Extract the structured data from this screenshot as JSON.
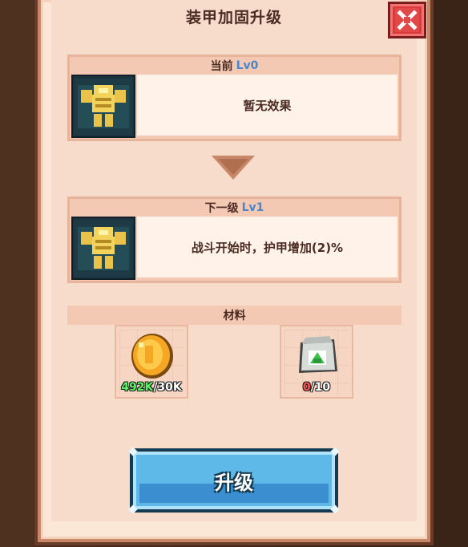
{
  "dialog": {
    "title": "装甲加固升级"
  },
  "current": {
    "label": "当前",
    "level": "Lv0",
    "effect": "暂无效果"
  },
  "next": {
    "label": "下一级",
    "level": "Lv1",
    "effect": "战斗开始时，护甲增加(2)%"
  },
  "materials": {
    "header": "材料",
    "items": [
      {
        "name": "coin",
        "have": "492K",
        "need": "/30K",
        "have_status": "sufficient"
      },
      {
        "name": "material-bag",
        "have": "0",
        "need": "/10",
        "have_status": "insufficient"
      }
    ]
  },
  "upgrade_button": {
    "label": "升级"
  },
  "colors": {
    "accent_blue": "#5fb9e8",
    "level_blue": "#4a86c9",
    "sufficient_green": "#5cf06a",
    "insufficient_red": "#ff5050",
    "close_red": "#d93b3b"
  },
  "icons": [
    "close-icon",
    "armor-icon",
    "down-arrow-icon",
    "coin-icon",
    "material-bag-icon"
  ]
}
